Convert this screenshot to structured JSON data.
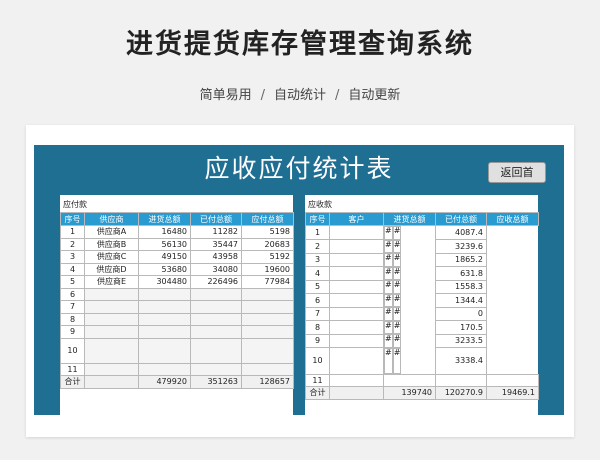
{
  "page": {
    "title": "进货提货库存管理查询系统",
    "subtitle_items": [
      "简单易用",
      "自动统计",
      "自动更新"
    ],
    "separator": "/"
  },
  "report": {
    "title": "应收应付统计表",
    "back_button": "返回首"
  },
  "payable": {
    "label": "应付款",
    "headers": [
      "序号",
      "供应商",
      "进货总额",
      "已付总额",
      "应付总额"
    ],
    "rows": [
      [
        "1",
        "供应商A",
        "16480",
        "11282",
        "5198"
      ],
      [
        "2",
        "供应商B",
        "56130",
        "35447",
        "20683"
      ],
      [
        "3",
        "供应商C",
        "49150",
        "43958",
        "5192"
      ],
      [
        "4",
        "供应商D",
        "53680",
        "34080",
        "19600"
      ],
      [
        "5",
        "供应商E",
        "304480",
        "226496",
        "77984"
      ],
      [
        "6",
        "",
        "",
        "",
        ""
      ],
      [
        "7",
        "",
        "",
        "",
        ""
      ],
      [
        "8",
        "",
        "",
        "",
        ""
      ],
      [
        "9",
        "",
        "",
        "",
        ""
      ],
      [
        "10",
        "",
        "",
        "",
        ""
      ],
      [
        "11",
        "",
        "",
        "",
        ""
      ]
    ],
    "total": [
      "合计",
      "",
      "479920",
      "351263",
      "128657"
    ]
  },
  "receivable": {
    "label": "应收款",
    "headers": [
      "序号",
      "客户",
      "进货总额",
      "已付总额",
      "应收总额"
    ],
    "rows": [
      [
        "1",
        "",
        "#",
        "#",
        "4087.4"
      ],
      [
        "2",
        "",
        "#",
        "#",
        "3239.6"
      ],
      [
        "3",
        "",
        "#",
        "#",
        "1865.2"
      ],
      [
        "4",
        "",
        "#",
        "#",
        "631.8"
      ],
      [
        "5",
        "",
        "#",
        "#",
        "1558.3"
      ],
      [
        "6",
        "",
        "#",
        "#",
        "1344.4"
      ],
      [
        "7",
        "",
        "#",
        "#",
        "0"
      ],
      [
        "8",
        "",
        "#",
        "#",
        "170.5"
      ],
      [
        "9",
        "",
        "#",
        "#",
        "3233.5"
      ],
      [
        "10",
        "",
        "#",
        "#",
        "3338.4"
      ],
      [
        "11",
        "",
        "",
        "",
        ""
      ]
    ],
    "total": [
      "合计",
      "",
      "139740",
      "120270.9",
      "19469.1"
    ]
  }
}
